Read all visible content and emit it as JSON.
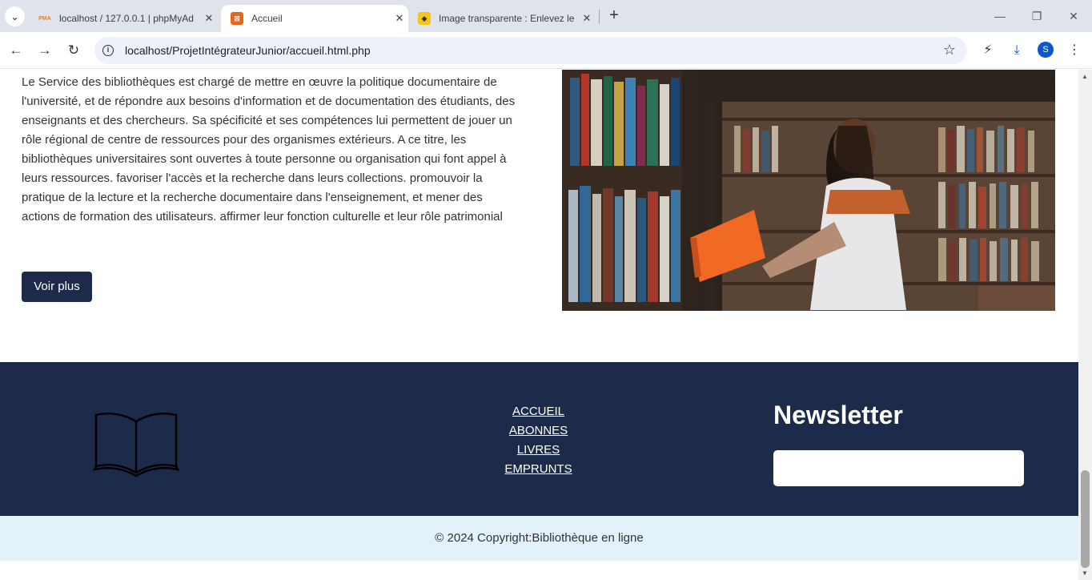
{
  "browser": {
    "tabs": [
      {
        "title": "localhost / 127.0.0.1 | phpMyAd",
        "favicon": "pma-icon"
      },
      {
        "title": "Accueil",
        "favicon": "xampp-icon"
      },
      {
        "title": "Image transparente : Enlevez le",
        "favicon": "removebg-icon"
      }
    ],
    "url": "localhost/ProjetIntégrateurJunior/accueil.html.php",
    "profile_initial": "S"
  },
  "main": {
    "description": "Le Service des bibliothèques est chargé de mettre en œuvre la politique documentaire de l'université, et de répondre aux besoins d'information et de documentation des étudiants, des enseignants et des chercheurs. Sa spécificité et ses compétences lui permettent de jouer un rôle régional de centre de ressources pour des organismes extérieurs. A ce titre, les bibliothèques universitaires sont ouvertes à toute personne ou organisation qui font appel à leurs ressources. favoriser l'accès et la recherche dans leurs collections. promouvoir la pratique de la lecture et la recherche documentaire dans l'enseignement, et mener des actions de formation des utilisateurs. affirmer leur fonction culturelle et leur rôle patrimonial",
    "more_button": "Voir plus"
  },
  "footer": {
    "links": [
      "ACCUEIL",
      "ABONNES",
      "LIVRES",
      "EMPRUNTS"
    ],
    "newsletter_title": "Newsletter",
    "newsletter_placeholder": "",
    "copyright": "© 2024 Copyright:Bibliothèque en ligne"
  },
  "colors": {
    "footer_bg": "#1d2b4b",
    "copyright_bg": "#e3f1fb",
    "button_bg": "#1d2b4b"
  }
}
